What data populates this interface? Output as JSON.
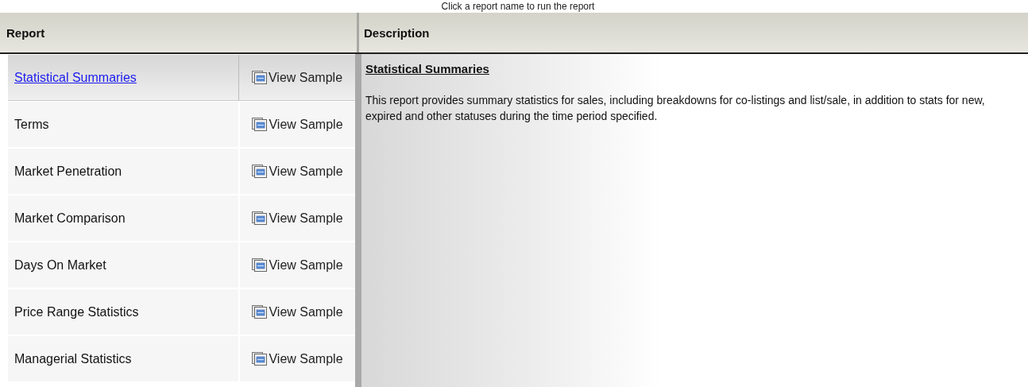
{
  "hint": "Click a report name to run the report",
  "columns": [
    "Report",
    "Description"
  ],
  "reports": [
    {
      "name": "Statistical Summaries",
      "action": "View Sample",
      "selected": true
    },
    {
      "name": "Terms",
      "action": "View Sample",
      "selected": false
    },
    {
      "name": "Market Penetration",
      "action": "View Sample",
      "selected": false
    },
    {
      "name": "Market Comparison",
      "action": "View Sample",
      "selected": false
    },
    {
      "name": "Days On Market",
      "action": "View Sample",
      "selected": false
    },
    {
      "name": "Price Range Statistics",
      "action": "View Sample",
      "selected": false
    },
    {
      "name": "Managerial Statistics",
      "action": "View Sample",
      "selected": false
    }
  ],
  "description": {
    "title": "Statistical Summaries",
    "text": "This report provides summary statistics for sales, including breakdowns for co-listings and list/sale, in addition to stats for new, expired and other statuses during the time period specified."
  }
}
